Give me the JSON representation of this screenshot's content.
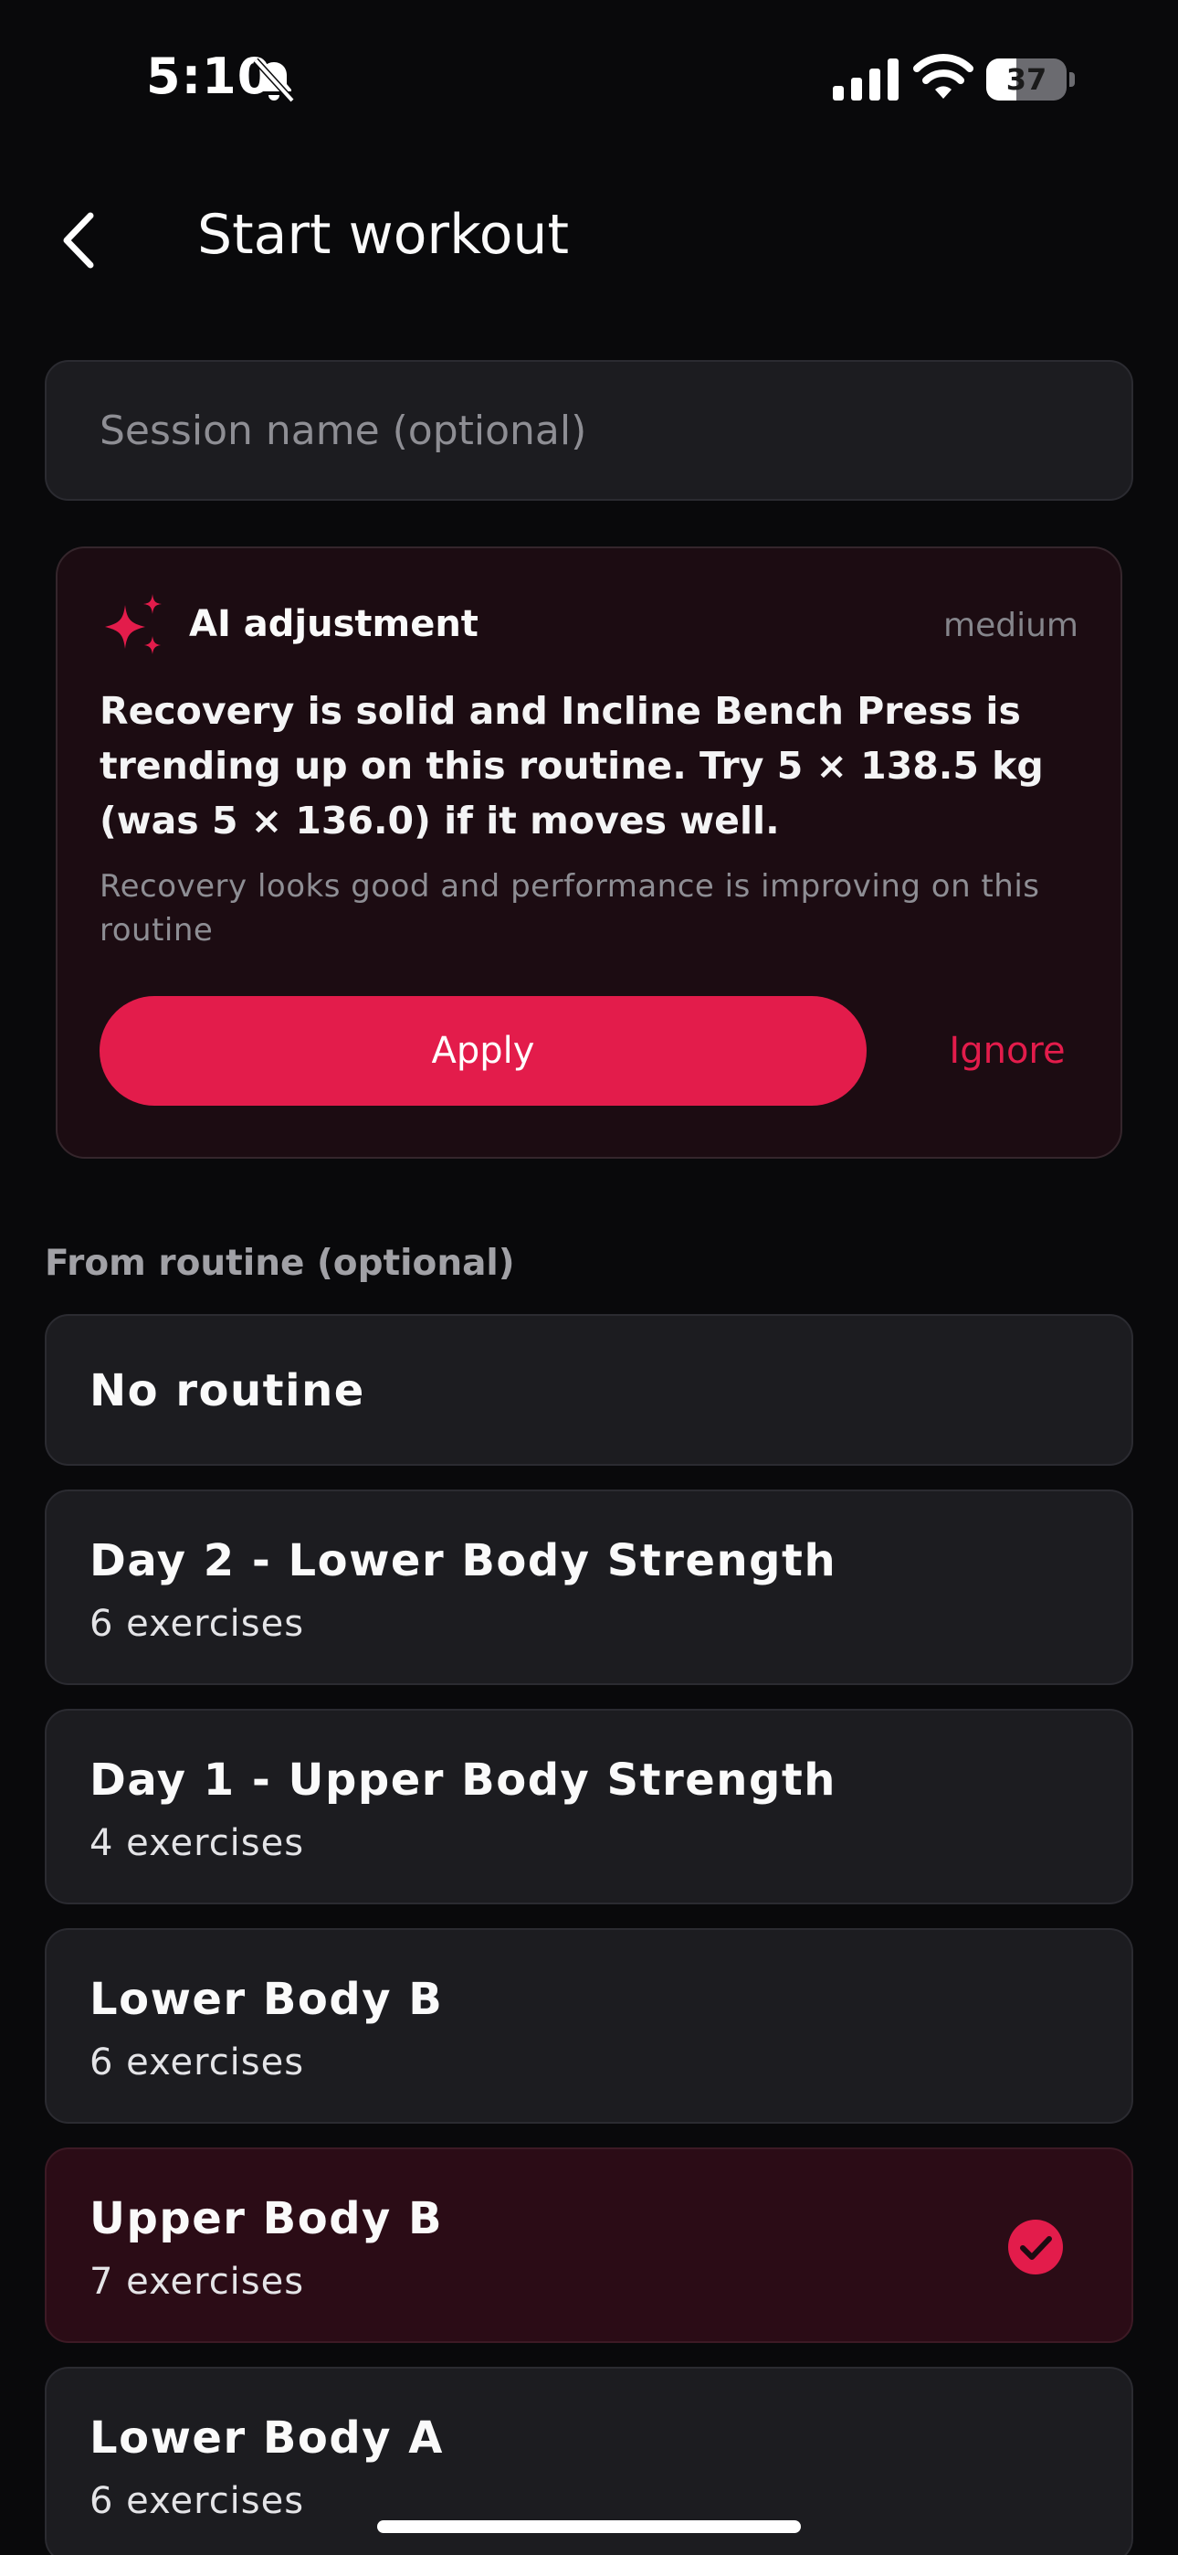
{
  "status_bar": {
    "time": "5:10",
    "battery_level": "37",
    "battery_fraction": 0.37
  },
  "header": {
    "title": "Start workout"
  },
  "session": {
    "value": "",
    "placeholder": "Session name (optional)"
  },
  "ai_card": {
    "title": "AI adjustment",
    "level": "medium",
    "message": "Recovery is solid and Incline Bench Press is trending up on this routine. Try 5 × 138.5 kg (was 5 × 136.0) if it moves well.",
    "reason": "Recovery looks good and performance is improving on this routine",
    "apply_label": "Apply",
    "ignore_label": "Ignore"
  },
  "routines": {
    "section_label": "From routine (optional)",
    "items": [
      {
        "name": "No routine",
        "count": "",
        "selected": false
      },
      {
        "name": "Day 2 - Lower Body Strength",
        "count": "6 exercises",
        "selected": false
      },
      {
        "name": "Day 1 - Upper Body Strength",
        "count": "4 exercises",
        "selected": false
      },
      {
        "name": "Lower Body B",
        "count": "6 exercises",
        "selected": false
      },
      {
        "name": "Upper Body B",
        "count": "7 exercises",
        "selected": true
      },
      {
        "name": "Lower Body A",
        "count": "6 exercises",
        "selected": false
      }
    ]
  },
  "colors": {
    "accent": "#e31c4b",
    "background": "#09090b",
    "card": "#1c1c20",
    "selected_card": "#2b0c16"
  },
  "icons": [
    "bell-slash-icon",
    "signal-icon",
    "wifi-icon",
    "battery-icon",
    "chevron-left-icon",
    "sparkle-icon",
    "check-circle-icon"
  ]
}
